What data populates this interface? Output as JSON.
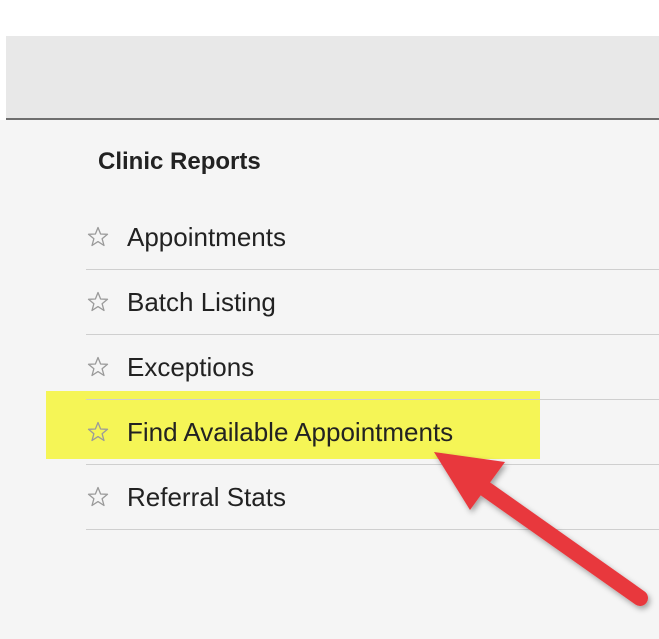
{
  "section": {
    "title": "Clinic Reports"
  },
  "reports": [
    {
      "label": "Appointments",
      "icon": "star-outline-icon"
    },
    {
      "label": "Batch Listing",
      "icon": "star-outline-icon"
    },
    {
      "label": "Exceptions",
      "icon": "star-outline-icon"
    },
    {
      "label": "Find Available Appointments",
      "icon": "star-outline-icon",
      "highlighted": true
    },
    {
      "label": "Referral Stats",
      "icon": "star-outline-icon"
    }
  ],
  "colors": {
    "highlight": "#f5f53a",
    "arrow": "#e8383d",
    "header_bg": "#e8e8e8",
    "content_bg": "#f5f5f5"
  }
}
